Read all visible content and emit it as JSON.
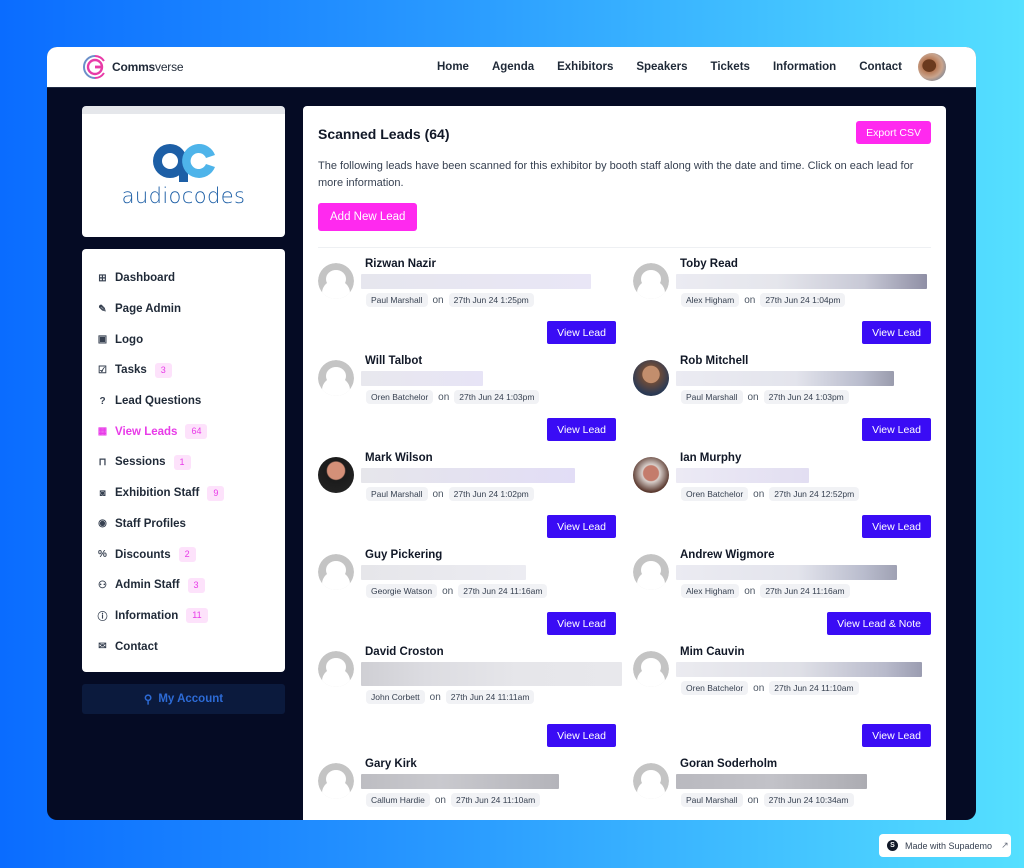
{
  "brand": {
    "name_bold": "Comms",
    "name_light": "verse"
  },
  "nav": {
    "items": [
      "Home",
      "Agenda",
      "Exhibitors",
      "Speakers",
      "Tickets",
      "Information",
      "Contact"
    ],
    "avatar_icon": "user-avatar"
  },
  "exhibitor": {
    "logo_text": "audiocodes"
  },
  "sidebar": {
    "items": [
      {
        "label": "Dashboard",
        "icon": "rss-icon",
        "glyph": "⊞",
        "badge": null,
        "active": false
      },
      {
        "label": "Page Admin",
        "icon": "edit-icon",
        "glyph": "✎",
        "badge": null,
        "active": false
      },
      {
        "label": "Logo",
        "icon": "image-icon",
        "glyph": "▣",
        "badge": null,
        "active": false
      },
      {
        "label": "Tasks",
        "icon": "checkbox-icon",
        "glyph": "☑",
        "badge": "3",
        "active": false
      },
      {
        "label": "Lead Questions",
        "icon": "question-icon",
        "glyph": "?",
        "badge": null,
        "active": false
      },
      {
        "label": "View Leads",
        "icon": "qr-code-icon",
        "glyph": "▦",
        "badge": "64",
        "active": true
      },
      {
        "label": "Sessions",
        "icon": "presentation-icon",
        "glyph": "⊓",
        "badge": "1",
        "active": false
      },
      {
        "label": "Exhibition Staff",
        "icon": "id-badge-icon",
        "glyph": "◙",
        "badge": "9",
        "active": false
      },
      {
        "label": "Staff Profiles",
        "icon": "user-circle-icon",
        "glyph": "◉",
        "badge": null,
        "active": false
      },
      {
        "label": "Discounts",
        "icon": "percent-icon",
        "glyph": "%",
        "badge": "2",
        "active": false
      },
      {
        "label": "Admin Staff",
        "icon": "user-gear-icon",
        "glyph": "⚇",
        "badge": "3",
        "active": false
      },
      {
        "label": "Information",
        "icon": "info-icon",
        "glyph": "ⓘ",
        "badge": "11",
        "active": false
      },
      {
        "label": "Contact",
        "icon": "envelope-open-icon",
        "glyph": "✉",
        "badge": null,
        "active": false
      }
    ],
    "account_label": "My Account"
  },
  "main": {
    "title": "Scanned Leads (64)",
    "export_label": "Export CSV",
    "description": "The following leads have been scanned for this exhibitor by booth staff along with the date and time. Click on each lead for more information.",
    "add_label": "Add New Lead",
    "on_word": "on",
    "leads": [
      {
        "name": "Rizwan Nazir",
        "scanned_by": "Paul Marshall",
        "datetime": "27th Jun 24 1:25pm",
        "button": "View Lead",
        "avatar": "placeholder"
      },
      {
        "name": "Toby Read",
        "scanned_by": "Alex Higham",
        "datetime": "27th Jun 24 1:04pm",
        "button": "View Lead",
        "avatar": "placeholder"
      },
      {
        "name": "Will Talbot",
        "scanned_by": "Oren Batchelor",
        "datetime": "27th Jun 24 1:03pm",
        "button": "View Lead",
        "avatar": "placeholder"
      },
      {
        "name": "Rob Mitchell",
        "scanned_by": "Paul Marshall",
        "datetime": "27th Jun 24 1:03pm",
        "button": "View Lead",
        "avatar": "photo"
      },
      {
        "name": "Mark Wilson",
        "scanned_by": "Paul Marshall",
        "datetime": "27th Jun 24 1:02pm",
        "button": "View Lead",
        "avatar": "photo"
      },
      {
        "name": "Ian Murphy",
        "scanned_by": "Oren Batchelor",
        "datetime": "27th Jun 24 12:52pm",
        "button": "View Lead",
        "avatar": "photo"
      },
      {
        "name": "Guy Pickering",
        "scanned_by": "Georgie Watson",
        "datetime": "27th Jun 24 11:16am",
        "button": "View Lead",
        "avatar": "placeholder"
      },
      {
        "name": "Andrew Wigmore",
        "scanned_by": "Alex Higham",
        "datetime": "27th Jun 24 11:16am",
        "button": "View Lead & Note",
        "avatar": "placeholder"
      },
      {
        "name": "David Croston",
        "scanned_by": "John Corbett",
        "datetime": "27th Jun 24 11:11am",
        "button": "View Lead",
        "avatar": "placeholder"
      },
      {
        "name": "Mim Cauvin",
        "scanned_by": "Oren Batchelor",
        "datetime": "27th Jun 24 11:10am",
        "button": "View Lead",
        "avatar": "placeholder"
      },
      {
        "name": "Gary Kirk",
        "scanned_by": "Callum Hardie",
        "datetime": "27th Jun 24 11:10am",
        "button": null,
        "avatar": "placeholder"
      },
      {
        "name": "Goran Soderholm",
        "scanned_by": "Paul Marshall",
        "datetime": "27th Jun 24 10:34am",
        "button": null,
        "avatar": "placeholder"
      }
    ]
  },
  "badge": {
    "label": "Made with Supademo",
    "logo_letter": "S"
  },
  "colors": {
    "accent_pink": "#ff29ef",
    "primary_button": "#3a0cf5",
    "frame_dark": "#050b24"
  }
}
